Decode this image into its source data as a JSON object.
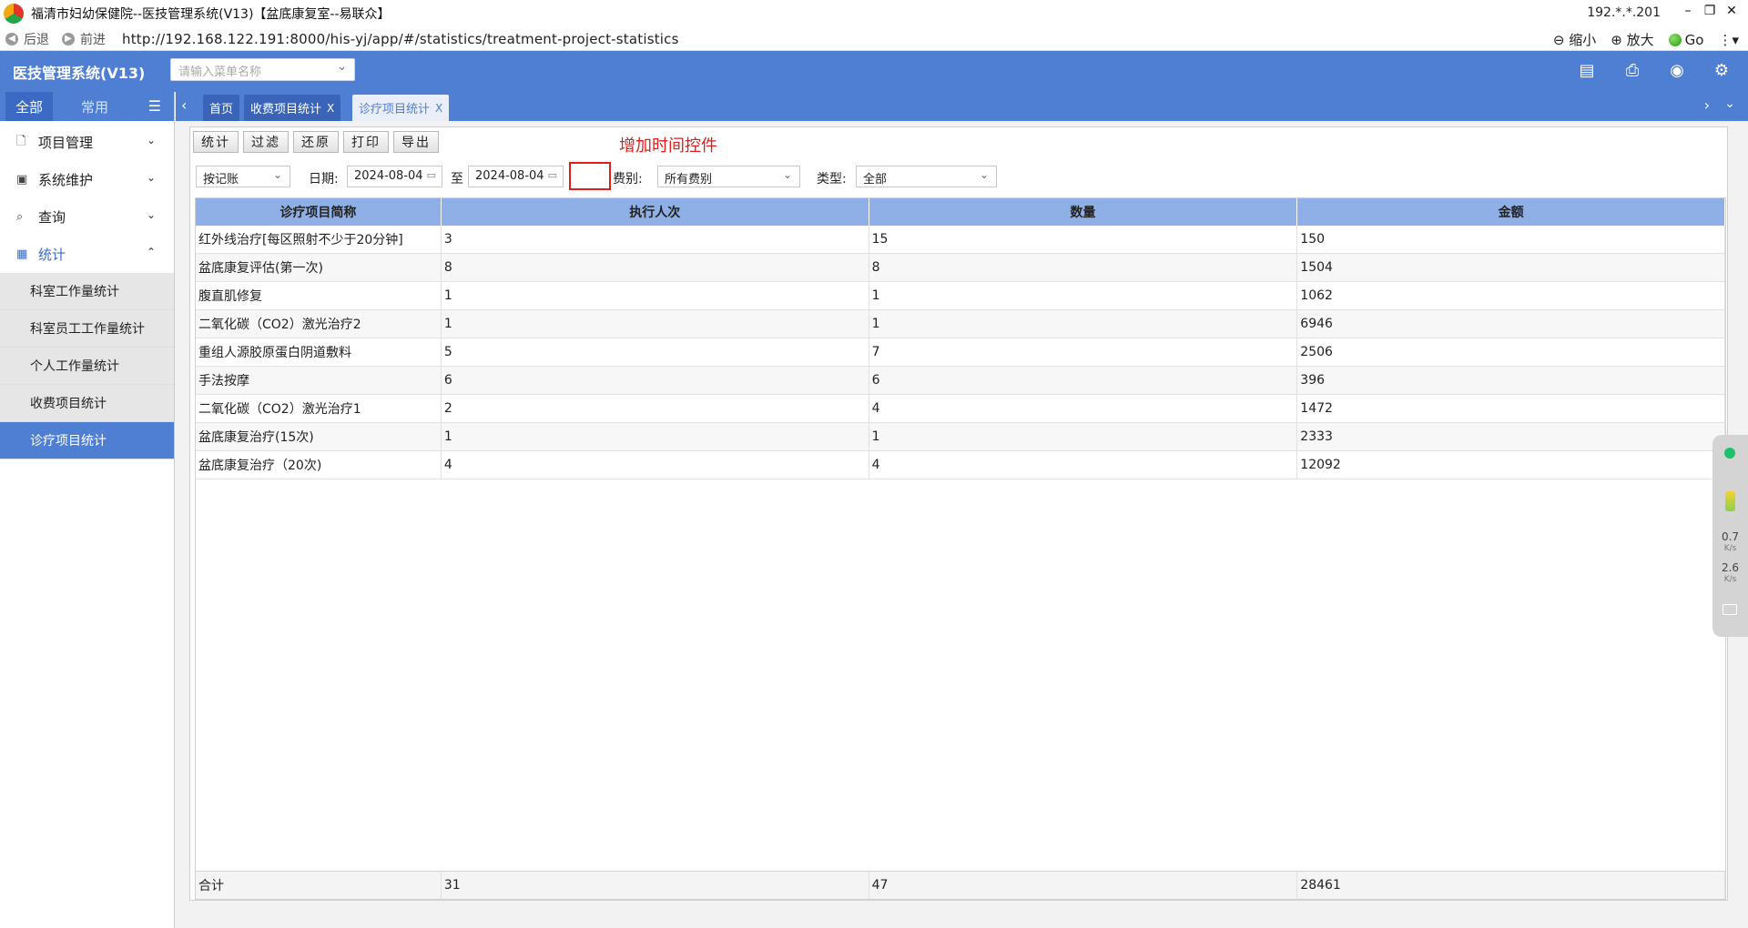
{
  "window": {
    "title": "福清市妇幼保健院--医技管理系统(V13)【盆底康复室--易联众】",
    "ip": "192.*.*.201"
  },
  "browser": {
    "back": "后退",
    "forward": "前进",
    "url": "http://192.168.122.191:8000/his-yj/app/#/statistics/treatment-project-statistics",
    "zoom_out": "缩小",
    "zoom_in": "放大",
    "go": "Go"
  },
  "header": {
    "title": "医技管理系统(V13)",
    "menu_search_placeholder": "请输入菜单名称"
  },
  "sidebar": {
    "tab_all": "全部",
    "tab_common": "常用",
    "groups": [
      {
        "label": "项目管理",
        "icon": "document-icon"
      },
      {
        "label": "系统维护",
        "icon": "monitor-icon"
      },
      {
        "label": "查询",
        "icon": "search-doc-icon"
      },
      {
        "label": "统计",
        "icon": "chart-icon"
      }
    ],
    "submenu": [
      "科室工作量统计",
      "科室员工工作量统计",
      "个人工作量统计",
      "收费项目统计",
      "诊疗项目统计"
    ]
  },
  "tabs": [
    "首页",
    "收费项目统计",
    "诊疗项目统计"
  ],
  "tab_close": "X",
  "toolbar": {
    "stat": "统计",
    "filter": "过滤",
    "restore": "还原",
    "print": "打印",
    "export": "导出"
  },
  "annotation": "增加时间控件",
  "filters": {
    "mode": "按记账",
    "date_label": "日期:",
    "date_from": "2024-08-04",
    "to_label": "至",
    "date_to": "2024-08-04",
    "fee_label": "费别:",
    "fee_value": "所有费别",
    "type_label": "类型:",
    "type_value": "全部"
  },
  "table": {
    "columns": [
      "诊疗项目简称",
      "执行人次",
      "数量",
      "金额"
    ],
    "rows": [
      [
        "红外线治疗[每区照射不少于20分钟]",
        "3",
        "15",
        "150"
      ],
      [
        "盆底康复评估(第一次)",
        "8",
        "8",
        "1504"
      ],
      [
        "腹直肌修复",
        "1",
        "1",
        "1062"
      ],
      [
        "二氧化碳（CO2）激光治疗2",
        "1",
        "1",
        "6946"
      ],
      [
        "重组人源胶原蛋白阴道敷料",
        "5",
        "7",
        "2506"
      ],
      [
        "手法按摩",
        "6",
        "6",
        "396"
      ],
      [
        "二氧化碳（CO2）激光治疗1",
        "2",
        "4",
        "1472"
      ],
      [
        "盆底康复治疗(15次)",
        "1",
        "1",
        "2333"
      ],
      [
        "盆底康复治疗（20次)",
        "4",
        "4",
        "12092"
      ]
    ],
    "footer": [
      "合计",
      "31",
      "47",
      "28461"
    ]
  },
  "widget": {
    "up": "0.7",
    "down": "2.6",
    "unit": "K/s"
  }
}
